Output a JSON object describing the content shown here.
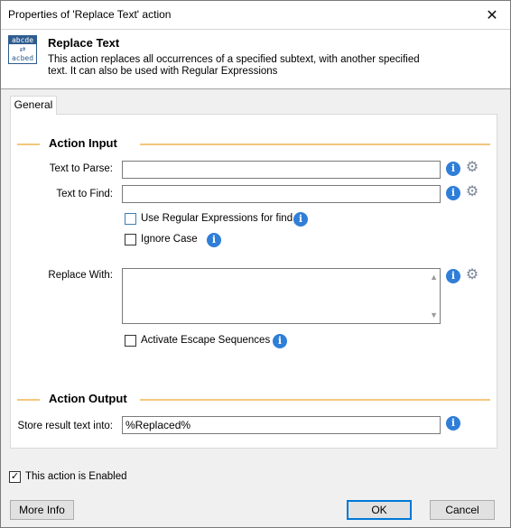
{
  "window": {
    "title": "Properties of 'Replace Text' action",
    "close_glyph": "✕"
  },
  "header": {
    "icon": {
      "top": "abcde",
      "mid": "⇄",
      "bot": "acbed"
    },
    "title": "Replace Text",
    "description": "This action replaces all occurrences of a specified subtext, with another specified text. It can also be used with Regular Expressions"
  },
  "tabs": [
    {
      "label": "General"
    }
  ],
  "input_section": {
    "title": "Action Input",
    "text_to_parse": {
      "label": "Text to Parse:",
      "value": ""
    },
    "text_to_find": {
      "label": "Text to Find:",
      "value": ""
    },
    "use_regex": {
      "label": "Use Regular Expressions for find",
      "checked": false
    },
    "ignore_case": {
      "label": "Ignore Case",
      "checked": false
    },
    "replace_with": {
      "label": "Replace With:",
      "value": ""
    },
    "escape_sequences": {
      "label": "Activate Escape Sequences",
      "checked": false
    }
  },
  "output_section": {
    "title": "Action Output",
    "store_result": {
      "label": "Store result text into:",
      "value": "%Replaced%"
    }
  },
  "footer": {
    "enabled": {
      "label": "This action is Enabled",
      "checked": true
    },
    "more_info": "More Info",
    "ok": "OK",
    "cancel": "Cancel"
  },
  "icons": {
    "info": "i",
    "gear": "⚙",
    "check": "✓"
  }
}
